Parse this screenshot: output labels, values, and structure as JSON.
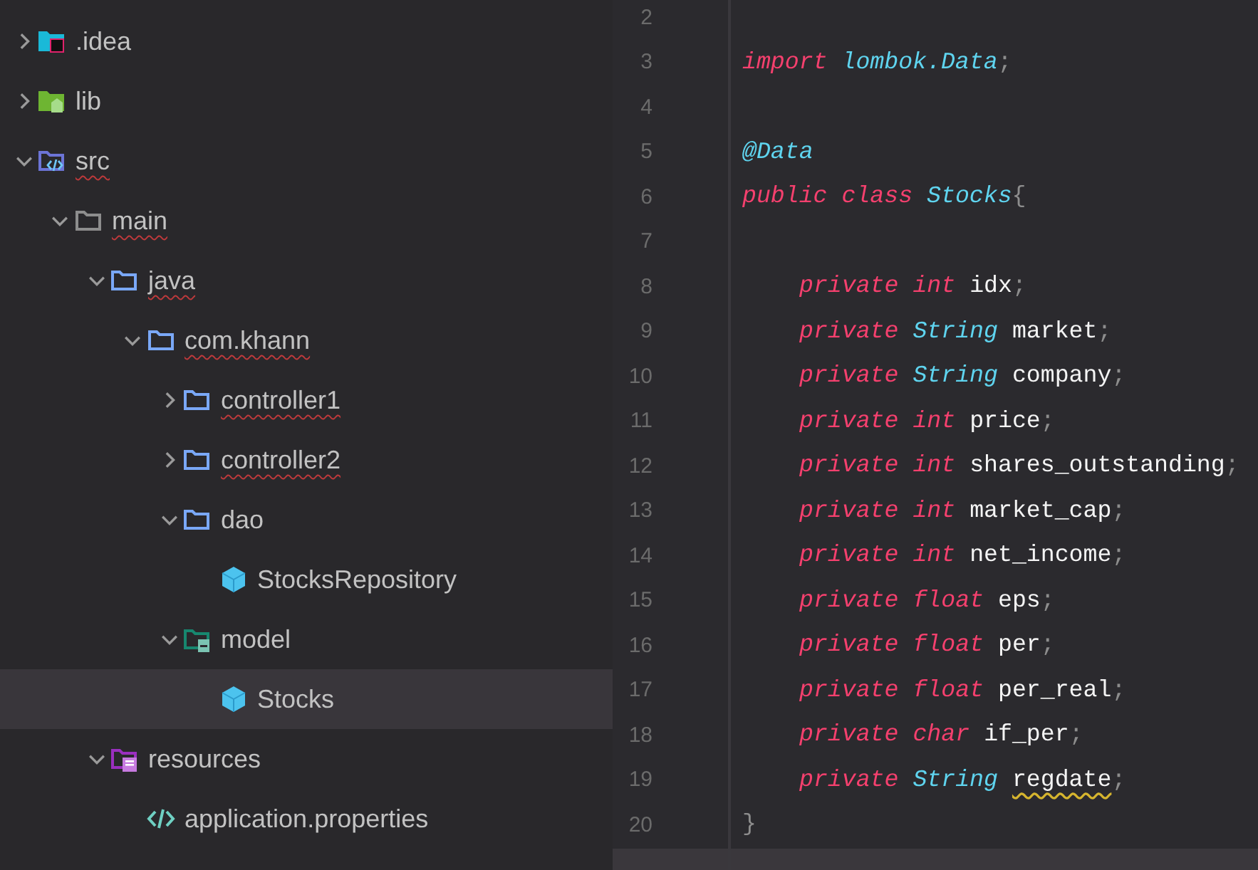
{
  "project_tree": [
    {
      "label": ".idea",
      "kind": "idea-folder",
      "expanded": false,
      "misspelled": false,
      "selected": false
    },
    {
      "label": "lib",
      "kind": "library-folder",
      "expanded": false,
      "misspelled": false,
      "selected": false
    },
    {
      "label": "src",
      "kind": "source-folder",
      "expanded": true,
      "misspelled": true,
      "selected": false,
      "children": [
        {
          "label": "main",
          "kind": "plain-folder",
          "expanded": true,
          "misspelled": true,
          "selected": false,
          "children": [
            {
              "label": "java",
              "kind": "package-folder",
              "expanded": true,
              "misspelled": true,
              "selected": false,
              "children": [
                {
                  "label": "com.khann",
                  "kind": "package-folder",
                  "expanded": true,
                  "misspelled": true,
                  "selected": false,
                  "children": [
                    {
                      "label": "controller1",
                      "kind": "package-folder",
                      "expanded": false,
                      "misspelled": true,
                      "selected": false
                    },
                    {
                      "label": "controller2",
                      "kind": "package-folder",
                      "expanded": false,
                      "misspelled": true,
                      "selected": false
                    },
                    {
                      "label": "dao",
                      "kind": "package-folder",
                      "expanded": true,
                      "misspelled": false,
                      "selected": false,
                      "children": [
                        {
                          "label": "StocksRepository",
                          "kind": "class-file",
                          "misspelled": false,
                          "selected": false
                        }
                      ]
                    },
                    {
                      "label": "model",
                      "kind": "model-folder",
                      "expanded": true,
                      "misspelled": false,
                      "selected": false,
                      "children": [
                        {
                          "label": "Stocks",
                          "kind": "class-file",
                          "misspelled": false,
                          "selected": true
                        }
                      ]
                    }
                  ]
                }
              ]
            },
            {
              "label": "resources",
              "kind": "resources-folder",
              "expanded": true,
              "misspelled": false,
              "selected": false,
              "children": [
                {
                  "label": "application.properties",
                  "kind": "properties-file",
                  "misspelled": false,
                  "selected": false
                }
              ]
            }
          ]
        }
      ]
    }
  ],
  "editor": {
    "lines": [
      {
        "number": "2",
        "current": false
      },
      {
        "number": "3",
        "indented": false,
        "current": false,
        "tokens": [
          {
            "kind": "keyword",
            "text": "import"
          },
          {
            "kind": "type",
            "text": "lombok.Data"
          },
          {
            "kind": "punct",
            "text": ";"
          }
        ]
      },
      {
        "number": "4",
        "current": false
      },
      {
        "number": "5",
        "indented": false,
        "current": false,
        "tokens": [
          {
            "kind": "type",
            "text": "@Data"
          }
        ]
      },
      {
        "number": "6",
        "indented": false,
        "current": false,
        "tokens": [
          {
            "kind": "keyword",
            "text": "public"
          },
          {
            "kind": "keyword",
            "text": "class"
          },
          {
            "kind": "type",
            "text": "Stocks"
          },
          {
            "kind": "punct",
            "text": "{"
          }
        ]
      },
      {
        "number": "7",
        "current": false
      },
      {
        "number": "8",
        "indented": true,
        "current": false,
        "tokens": [
          {
            "kind": "keyword",
            "text": "private"
          },
          {
            "kind": "keyword",
            "text": "int"
          },
          {
            "kind": "ident",
            "text": "idx"
          },
          {
            "kind": "punct",
            "text": ";"
          }
        ]
      },
      {
        "number": "9",
        "indented": true,
        "current": false,
        "tokens": [
          {
            "kind": "keyword",
            "text": "private"
          },
          {
            "kind": "type",
            "text": "String"
          },
          {
            "kind": "ident",
            "text": "market"
          },
          {
            "kind": "punct",
            "text": ";"
          }
        ]
      },
      {
        "number": "10",
        "indented": true,
        "current": false,
        "tokens": [
          {
            "kind": "keyword",
            "text": "private"
          },
          {
            "kind": "type",
            "text": "String"
          },
          {
            "kind": "ident",
            "text": "company"
          },
          {
            "kind": "punct",
            "text": ";"
          }
        ]
      },
      {
        "number": "11",
        "indented": true,
        "current": false,
        "tokens": [
          {
            "kind": "keyword",
            "text": "private"
          },
          {
            "kind": "keyword",
            "text": "int"
          },
          {
            "kind": "ident",
            "text": "price"
          },
          {
            "kind": "punct",
            "text": ";"
          }
        ]
      },
      {
        "number": "12",
        "indented": true,
        "current": false,
        "tokens": [
          {
            "kind": "keyword",
            "text": "private"
          },
          {
            "kind": "keyword",
            "text": "int"
          },
          {
            "kind": "ident",
            "text": "shares_outstanding"
          },
          {
            "kind": "punct",
            "text": ";"
          }
        ]
      },
      {
        "number": "13",
        "indented": true,
        "current": false,
        "tokens": [
          {
            "kind": "keyword",
            "text": "private"
          },
          {
            "kind": "keyword",
            "text": "int"
          },
          {
            "kind": "ident",
            "text": "market_cap"
          },
          {
            "kind": "punct",
            "text": ";"
          }
        ]
      },
      {
        "number": "14",
        "indented": true,
        "current": false,
        "tokens": [
          {
            "kind": "keyword",
            "text": "private"
          },
          {
            "kind": "keyword",
            "text": "int"
          },
          {
            "kind": "ident",
            "text": "net_income"
          },
          {
            "kind": "punct",
            "text": ";"
          }
        ]
      },
      {
        "number": "15",
        "indented": true,
        "current": false,
        "tokens": [
          {
            "kind": "keyword",
            "text": "private"
          },
          {
            "kind": "keyword",
            "text": "float"
          },
          {
            "kind": "ident",
            "text": "eps"
          },
          {
            "kind": "punct",
            "text": ";"
          }
        ]
      },
      {
        "number": "16",
        "indented": true,
        "current": false,
        "tokens": [
          {
            "kind": "keyword",
            "text": "private"
          },
          {
            "kind": "keyword",
            "text": "float"
          },
          {
            "kind": "ident",
            "text": "per"
          },
          {
            "kind": "punct",
            "text": ";"
          }
        ]
      },
      {
        "number": "17",
        "indented": true,
        "current": false,
        "tokens": [
          {
            "kind": "keyword",
            "text": "private"
          },
          {
            "kind": "keyword",
            "text": "float"
          },
          {
            "kind": "ident",
            "text": "per_real"
          },
          {
            "kind": "punct",
            "text": ";"
          }
        ]
      },
      {
        "number": "18",
        "indented": true,
        "current": false,
        "tokens": [
          {
            "kind": "keyword",
            "text": "private"
          },
          {
            "kind": "keyword",
            "text": "char"
          },
          {
            "kind": "ident",
            "text": "if_per"
          },
          {
            "kind": "punct",
            "text": ";"
          }
        ]
      },
      {
        "number": "19",
        "indented": true,
        "current": false,
        "tokens": [
          {
            "kind": "keyword",
            "text": "private"
          },
          {
            "kind": "type",
            "text": "String"
          },
          {
            "kind": "ident",
            "text": "regdate",
            "warning": true
          },
          {
            "kind": "punct",
            "text": ";"
          }
        ]
      },
      {
        "number": "20",
        "indented": false,
        "current": false,
        "tokens": [
          {
            "kind": "punct",
            "text": "}"
          }
        ]
      },
      {
        "current": true
      }
    ]
  }
}
